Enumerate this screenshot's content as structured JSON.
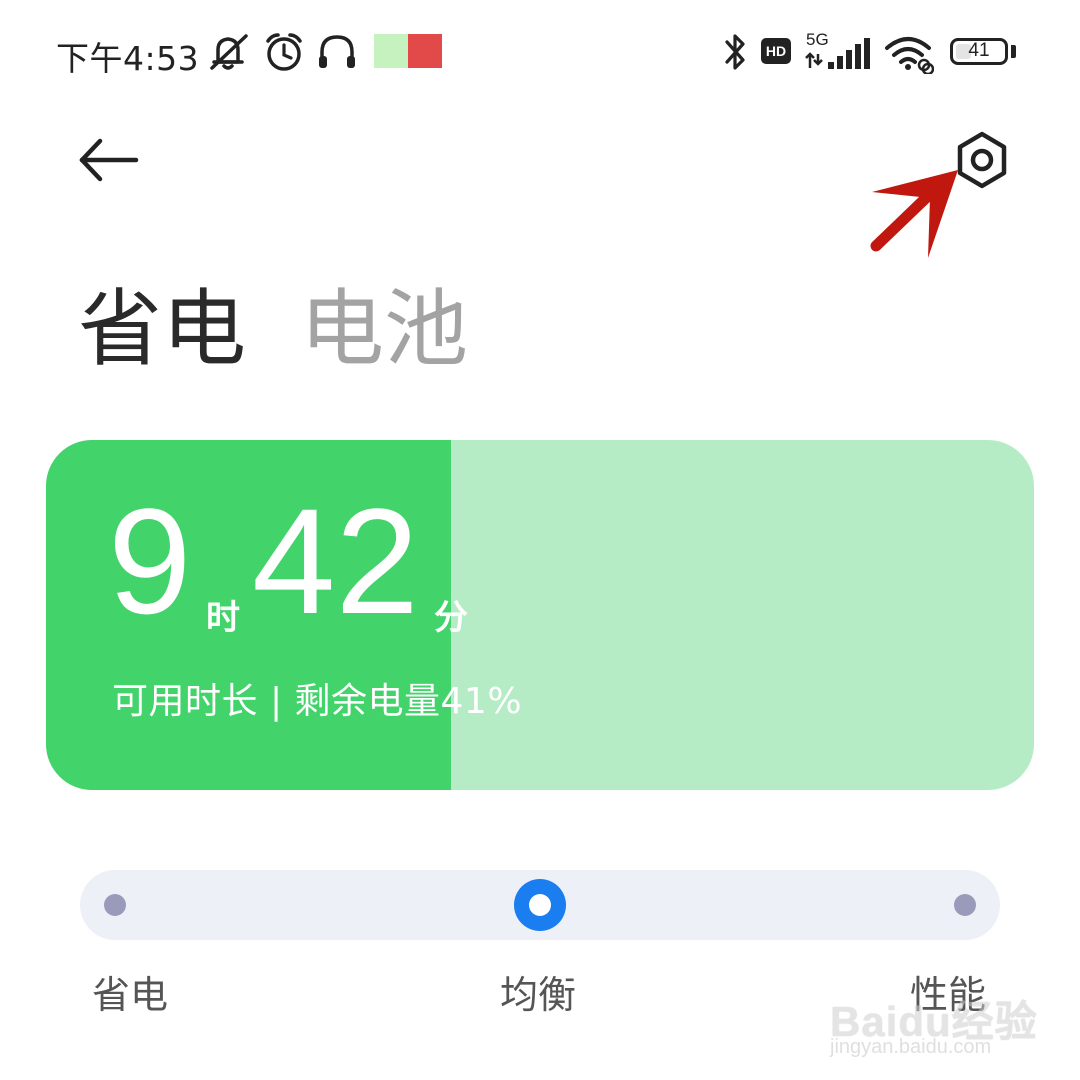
{
  "status_bar": {
    "time": "下午4:53",
    "icons": [
      "mute-bell-icon",
      "alarm-icon",
      "headphones-icon",
      "bluetooth-icon",
      "hd-icon",
      "signal-5g-icon",
      "wifi-icon",
      "battery-icon"
    ],
    "hd_label": "HD",
    "network_label": "5G",
    "battery_level": "41",
    "swatch_colors": [
      "#c6f2c0",
      "#e24a4a"
    ]
  },
  "header": {
    "back_icon": "back-arrow-icon",
    "settings_icon": "settings-hex-icon",
    "tabs": [
      {
        "label": "省电",
        "active": true
      },
      {
        "label": "电池",
        "active": false
      }
    ]
  },
  "card": {
    "hours": "9",
    "hours_unit": "时",
    "minutes": "42",
    "minutes_unit": "分",
    "subtitle": "可用时长 | 剩余电量41%",
    "fill_fraction": 0.41,
    "colors": {
      "fill": "#42d36b",
      "track": "#b5ecc6"
    }
  },
  "mode_slider": {
    "options": [
      "省电",
      "均衡",
      "性能"
    ],
    "selected": "均衡",
    "accent_color": "#1a7df0"
  },
  "watermark": {
    "logo": "Baidu经验",
    "url": "jingyan.baidu.com"
  }
}
